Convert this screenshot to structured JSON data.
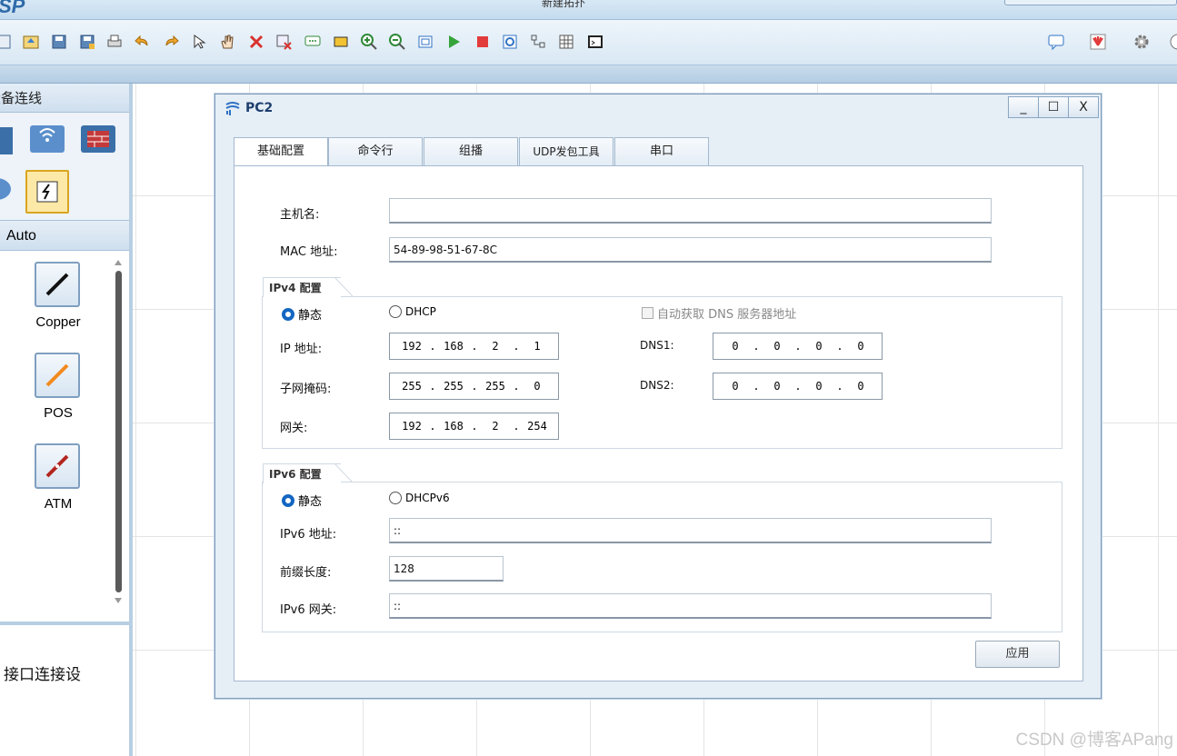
{
  "app": {
    "logo": "SP",
    "window_title": "新建拓扑"
  },
  "toolbar": {
    "left_icons": [
      "new-topology-icon",
      "open-icon",
      "save-icon",
      "save-as-icon",
      "print-icon",
      "undo-icon",
      "redo-icon",
      "select-pointer-icon",
      "pan-hand-icon",
      "delete-icon",
      "delete-connection-icon",
      "text-note-icon",
      "rectangle-icon",
      "zoom-in-icon",
      "zoom-out-icon",
      "fit-view-icon",
      "start-device-icon",
      "stop-device-icon",
      "capture-data-icon",
      "show-interfaces-icon",
      "grid-icon",
      "cli-icon"
    ],
    "right_icons": [
      "message-icon",
      "huawei-logo-icon",
      "settings-gear-icon"
    ],
    "colors": {
      "green": "#35a43a",
      "red": "#e23b3b",
      "blue": "#2f72c4"
    }
  },
  "left_panel": {
    "device_header": "设备连线",
    "connection_header": "Auto",
    "connections": [
      {
        "label": "Copper",
        "icon": "copper-cable-icon"
      },
      {
        "label": "POS",
        "icon": "pos-cable-icon"
      },
      {
        "label": "ATM",
        "icon": "atm-cable-icon"
      }
    ],
    "hint": "接口连接设"
  },
  "dialog": {
    "title": "PC2",
    "controls": {
      "minimize": "_",
      "maximize": "☐",
      "close": "X"
    },
    "tabs": [
      "基础配置",
      "命令行",
      "组播",
      "UDP发包工具",
      "串口"
    ],
    "active_tab": "基础配置",
    "hostname": {
      "label": "主机名:",
      "value": ""
    },
    "mac": {
      "label": "MAC 地址:",
      "value": "54-89-98-51-67-8C"
    },
    "ipv4": {
      "group_title": "IPv4 配置",
      "static_label": "静态",
      "dhcp_label": "DHCP",
      "auto_dns_label": "自动获取 DNS 服务器地址",
      "ip_label": "IP 地址:",
      "ip": [
        "192",
        "168",
        "2",
        "1"
      ],
      "mask_label": "子网掩码:",
      "mask": [
        "255",
        "255",
        "255",
        "0"
      ],
      "gateway_label": "网关:",
      "gateway": [
        "192",
        "168",
        "2",
        "254"
      ],
      "dns1_label": "DNS1:",
      "dns1": [
        "0",
        "0",
        "0",
        "0"
      ],
      "dns2_label": "DNS2:",
      "dns2": [
        "0",
        "0",
        "0",
        "0"
      ]
    },
    "ipv6": {
      "group_title": "IPv6 配置",
      "static_label": "静态",
      "dhcp_label": "DHCPv6",
      "address_label": "IPv6 地址:",
      "address": "::",
      "prefix_label": "前缀长度:",
      "prefix": "128",
      "gateway_label": "IPv6 网关:",
      "gateway": "::"
    },
    "apply_label": "应用"
  },
  "watermark": "CSDN @博客APang"
}
